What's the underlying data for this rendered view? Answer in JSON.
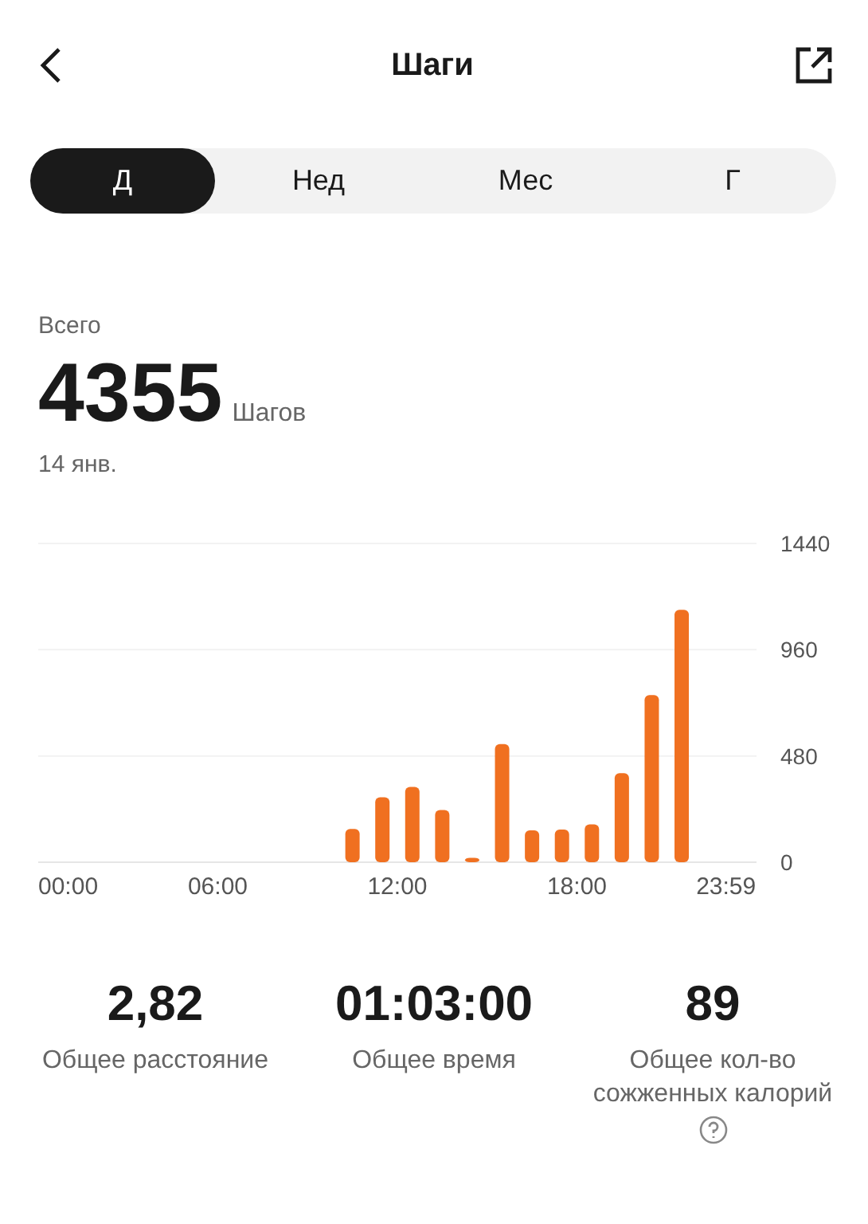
{
  "header": {
    "title": "Шаги"
  },
  "tabs": [
    {
      "label": "Д",
      "selected": true
    },
    {
      "label": "Нед",
      "selected": false
    },
    {
      "label": "Мес",
      "selected": false
    },
    {
      "label": "Г",
      "selected": false
    }
  ],
  "summary": {
    "label": "Всего",
    "value": "4355",
    "unit": "Шагов",
    "date": "14 янв."
  },
  "chart_data": {
    "type": "bar",
    "x": [
      10.5,
      11.5,
      12.5,
      13.5,
      14.5,
      15.5,
      16.5,
      17.5,
      18.5,
      19.5,
      20.5,
      21.5
    ],
    "series": [
      {
        "color": "#f07020",
        "values": [
          150,
          293,
          340,
          236,
          20,
          534,
          144,
          148,
          171,
          402,
          755,
          1140
        ]
      }
    ],
    "xlim": [
      0,
      24
    ],
    "ylim": [
      0,
      1440
    ],
    "xticks": [
      {
        "value": 0,
        "label": "00:00"
      },
      {
        "value": 6,
        "label": "06:00"
      },
      {
        "value": 12,
        "label": "12:00"
      },
      {
        "value": 18,
        "label": "18:00"
      },
      {
        "value": 23.98,
        "label": "23:59"
      }
    ],
    "yticks": [
      0,
      480,
      960,
      1440
    ]
  },
  "stats": [
    {
      "value": "2,82",
      "label": "Общее расстояние",
      "help": false
    },
    {
      "value": "01:03:00",
      "label": "Общее время",
      "help": false
    },
    {
      "value": "89",
      "label": "Общее кол-во сожженных калорий",
      "help": true
    }
  ]
}
